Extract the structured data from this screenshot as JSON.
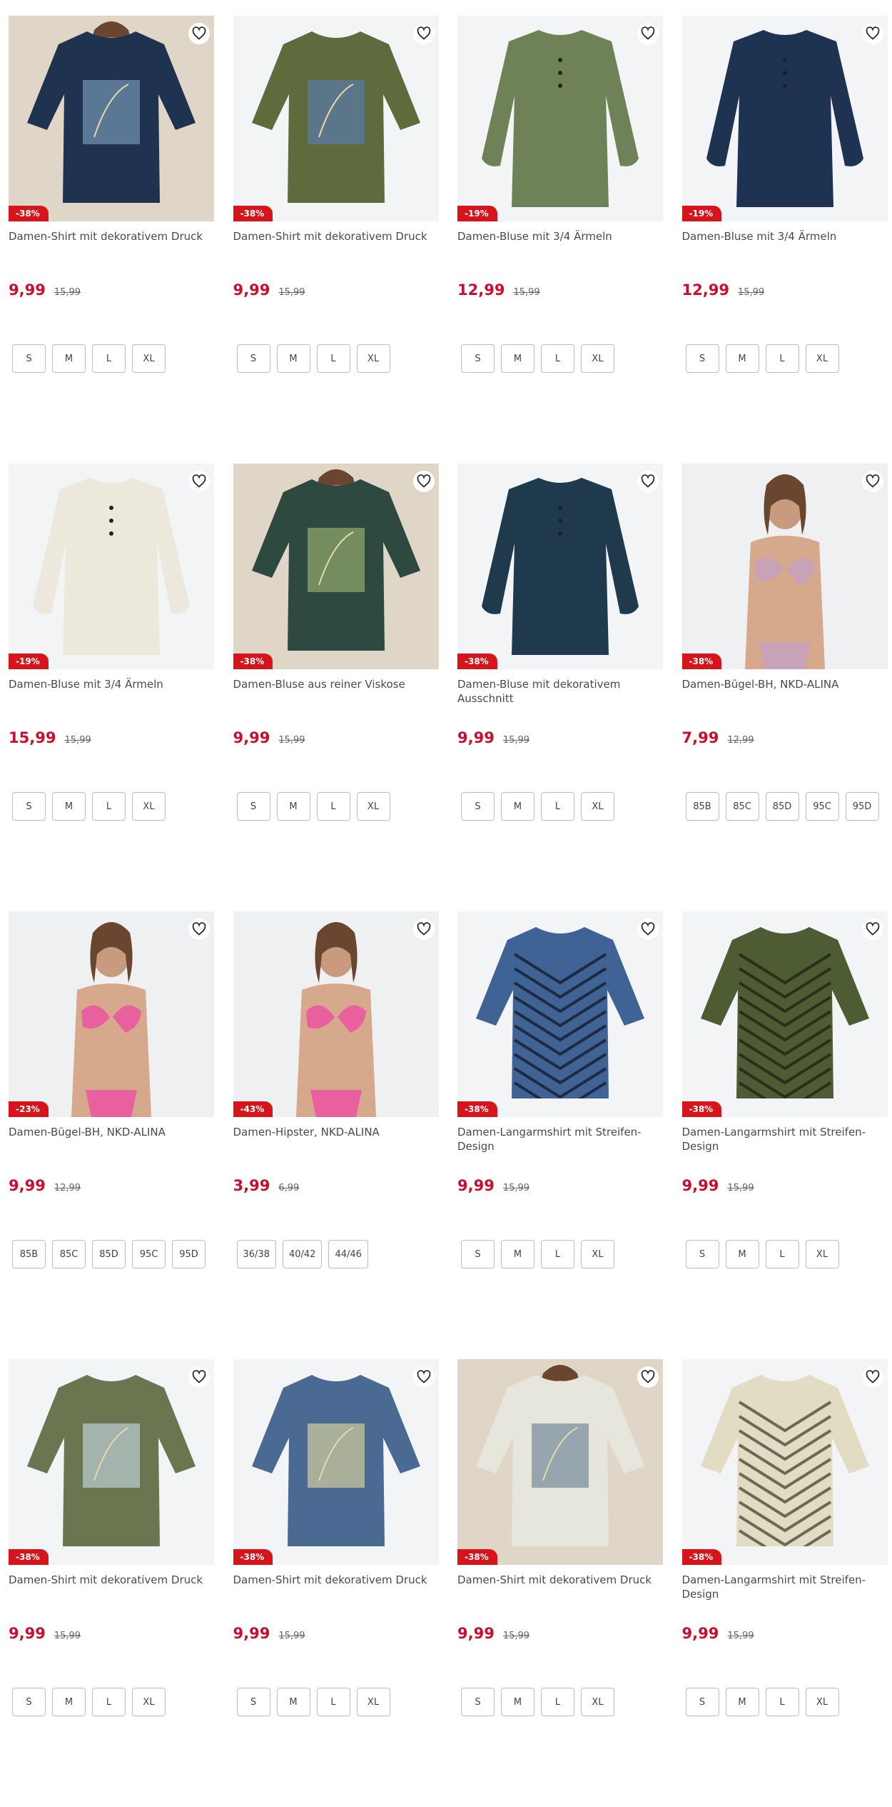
{
  "colors": {
    "price": "#c8102e",
    "badge": "#d5151b",
    "image_bg": "#f3f4f5"
  },
  "products": [
    {
      "title": "Damen-Shirt mit dekorativem Druck",
      "price": "9,99",
      "old_price": "15,99",
      "discount": "-38%",
      "sizes": [
        "S",
        "M",
        "L",
        "XL"
      ],
      "garment": "tshirt",
      "color": "#1f3350",
      "print": "#6f8fae",
      "model": true
    },
    {
      "title": "Damen-Shirt mit dekorativem Druck",
      "price": "9,99",
      "old_price": "15,99",
      "discount": "-38%",
      "sizes": [
        "S",
        "M",
        "L",
        "XL"
      ],
      "garment": "tshirt",
      "color": "#5f6b3c",
      "print": "#5a7aa3",
      "model": false
    },
    {
      "title": "Damen-Bluse mit 3/4 Ärmeln",
      "price": "12,99",
      "old_price": "15,99",
      "discount": "-19%",
      "sizes": [
        "S",
        "M",
        "L",
        "XL"
      ],
      "garment": "blouse",
      "color": "#6f8257",
      "print": "",
      "model": false
    },
    {
      "title": "Damen-Bluse mit 3/4 Ärmeln",
      "price": "12,99",
      "old_price": "15,99",
      "discount": "-19%",
      "sizes": [
        "S",
        "M",
        "L",
        "XL"
      ],
      "garment": "blouse",
      "color": "#1e3352",
      "print": "",
      "model": false
    },
    {
      "title": "Damen-Bluse mit 3/4 Ärmeln",
      "price": "15,99",
      "old_price": "15,99",
      "discount": "-19%",
      "sizes": [
        "S",
        "M",
        "L",
        "XL"
      ],
      "garment": "blouse",
      "color": "#ece8dc",
      "print": "",
      "model": false
    },
    {
      "title": "Damen-Bluse aus reiner Viskose",
      "price": "9,99",
      "old_price": "15,99",
      "discount": "-38%",
      "sizes": [
        "S",
        "M",
        "L",
        "XL"
      ],
      "garment": "tshirt",
      "color": "#2e4a40",
      "print": "#8ea36a",
      "model": true
    },
    {
      "title": "Damen-Bluse mit dekorativem Ausschnitt",
      "price": "9,99",
      "old_price": "15,99",
      "discount": "-38%",
      "sizes": [
        "S",
        "M",
        "L",
        "XL"
      ],
      "garment": "blouse",
      "color": "#1f3a4c",
      "print": "#7fa0b5",
      "model": false
    },
    {
      "title": "Damen-Bügel-BH, NKD-ALINA",
      "price": "7,99",
      "old_price": "12,99",
      "discount": "-38%",
      "sizes": [
        "85B",
        "85C",
        "85D",
        "95C",
        "95D"
      ],
      "garment": "bra",
      "color": "#c8a2b6",
      "print": "",
      "model": true
    },
    {
      "title": "Damen-Bügel-BH, NKD-ALINA",
      "price": "9,99",
      "old_price": "12,99",
      "discount": "-23%",
      "sizes": [
        "85B",
        "85C",
        "85D",
        "95C",
        "95D"
      ],
      "garment": "bra",
      "color": "#e8609e",
      "print": "",
      "model": true
    },
    {
      "title": "Damen-Hipster, NKD-ALINA",
      "price": "3,99",
      "old_price": "6,99",
      "discount": "-43%",
      "sizes": [
        "36/38",
        "40/42",
        "44/46"
      ],
      "garment": "bra",
      "color": "#e8609e",
      "print": "",
      "model": true
    },
    {
      "title": "Damen-Langarmshirt mit Streifen-Design",
      "price": "9,99",
      "old_price": "15,99",
      "discount": "-38%",
      "sizes": [
        "S",
        "M",
        "L",
        "XL"
      ],
      "garment": "stripes",
      "color": "#3f6394",
      "print": "#1d2c44",
      "model": false
    },
    {
      "title": "Damen-Langarmshirt mit Streifen-Design",
      "price": "9,99",
      "old_price": "15,99",
      "discount": "-38%",
      "sizes": [
        "S",
        "M",
        "L",
        "XL"
      ],
      "garment": "stripes",
      "color": "#4e5c33",
      "print": "#27301a",
      "model": false
    },
    {
      "title": "Damen-Shirt mit dekorativem Druck",
      "price": "9,99",
      "old_price": "15,99",
      "discount": "-38%",
      "sizes": [
        "S",
        "M",
        "L",
        "XL"
      ],
      "garment": "tshirt",
      "color": "#6b7550",
      "print": "#b7c8c9",
      "model": false
    },
    {
      "title": "Damen-Shirt mit dekorativem Druck",
      "price": "9,99",
      "old_price": "15,99",
      "discount": "-38%",
      "sizes": [
        "S",
        "M",
        "L",
        "XL"
      ],
      "garment": "tshirt",
      "color": "#4a6a93",
      "print": "#c9c79a",
      "model": false
    },
    {
      "title": "Damen-Shirt mit dekorativem Druck",
      "price": "9,99",
      "old_price": "15,99",
      "discount": "-38%",
      "sizes": [
        "S",
        "M",
        "L",
        "XL"
      ],
      "garment": "tshirt",
      "color": "#e7e6dd",
      "print": "#7b8f9e",
      "model": true
    },
    {
      "title": "Damen-Langarmshirt mit Streifen-Design",
      "price": "9,99",
      "old_price": "15,99",
      "discount": "-38%",
      "sizes": [
        "S",
        "M",
        "L",
        "XL"
      ],
      "garment": "stripes",
      "color": "#e3dcc4",
      "print": "#6c6a52",
      "model": false
    }
  ]
}
